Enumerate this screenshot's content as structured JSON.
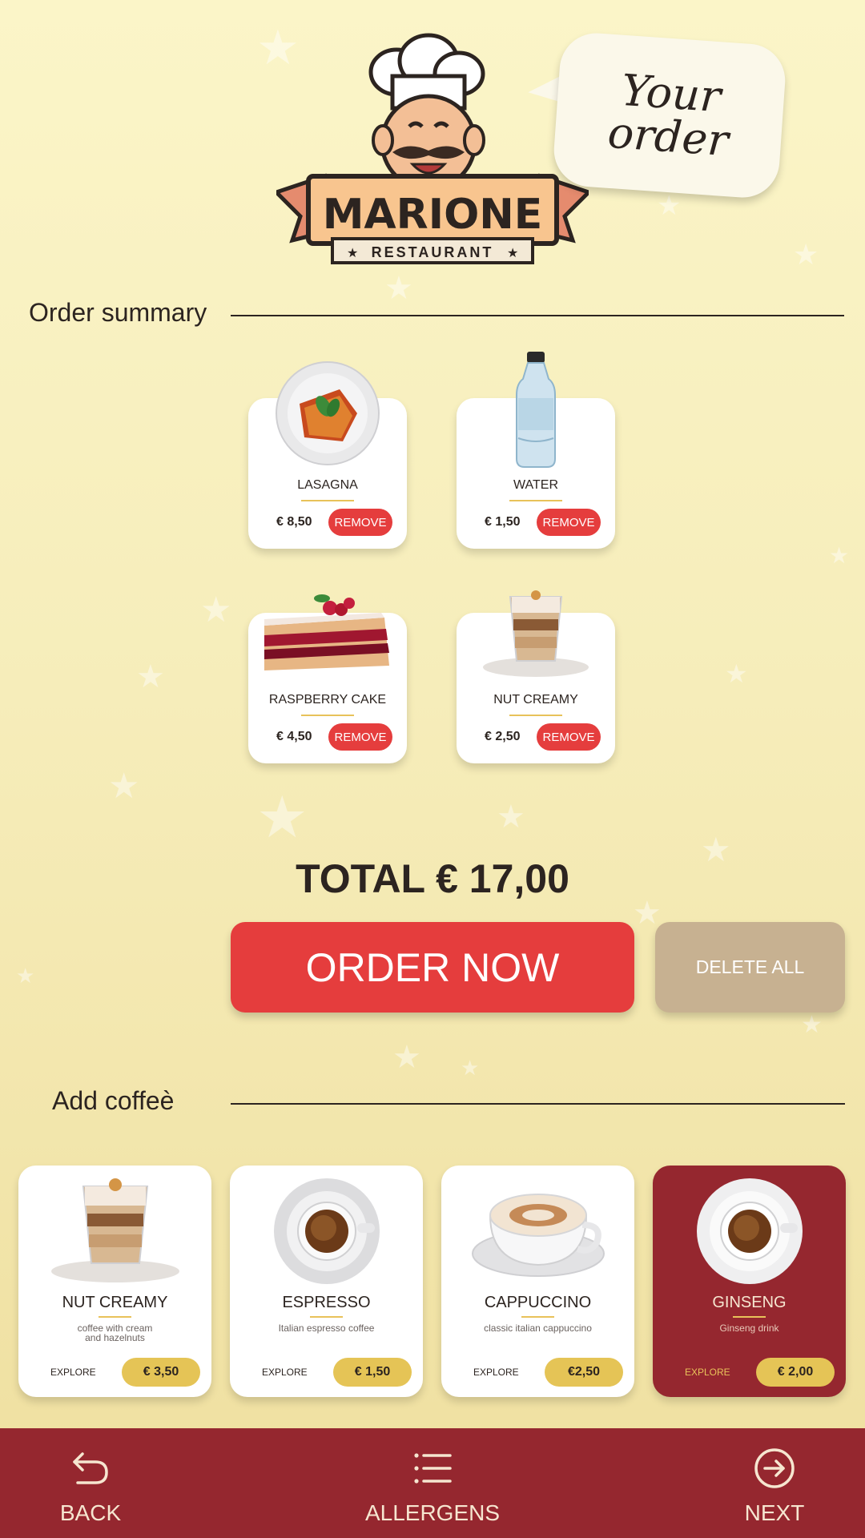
{
  "colors": {
    "accent_red": "#e53d3d",
    "nav_maroon": "#95272f",
    "price_yellow": "#e5c456",
    "delete_tan": "#c7b191"
  },
  "header": {
    "logo_name": "MARIONE",
    "logo_sub": "RESTAURANT",
    "bubble_text": "Your order"
  },
  "order_summary": {
    "title": "Order summary",
    "remove_label": "REMOVE",
    "items": [
      {
        "name": "LASAGNA",
        "price": "€ 8,50",
        "icon": "lasagna-plate"
      },
      {
        "name": "WATER",
        "price": "€ 1,50",
        "icon": "water-bottle"
      },
      {
        "name": "RASPBERRY CAKE",
        "price": "€ 4,50",
        "icon": "raspberry-cake-slice"
      },
      {
        "name": "NUT CREAMY",
        "price": "€ 2,50",
        "icon": "nut-creamy-glass"
      }
    ]
  },
  "total": {
    "text": "TOTAL € 17,00"
  },
  "actions": {
    "order_now": "ORDER NOW",
    "delete_all": "DELETE ALL"
  },
  "add_coffee": {
    "title": "Add coffeè",
    "explore_label": "EXPLORE",
    "items": [
      {
        "name": "NUT CREAMY",
        "desc": "coffee with cream\nand hazelnuts",
        "price": "€ 3,50",
        "selected": false
      },
      {
        "name": "ESPRESSO",
        "desc": "Italian espresso coffee",
        "price": "€ 1,50",
        "selected": false
      },
      {
        "name": "CAPPUCCINO",
        "desc": "classic italian cappuccino",
        "price": "€2,50",
        "selected": false
      },
      {
        "name": "GINSENG",
        "desc": "Ginseng drink",
        "price": "€ 2,00",
        "selected": true
      }
    ]
  },
  "nav": {
    "back": "BACK",
    "allergens": "ALLERGENS",
    "next": "NEXT"
  }
}
